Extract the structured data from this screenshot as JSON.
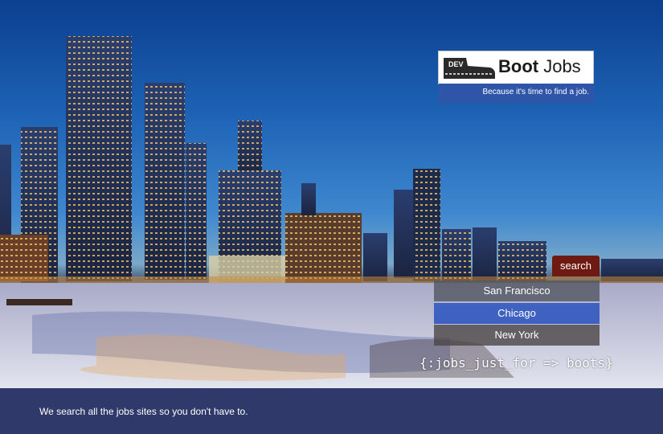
{
  "logo": {
    "icon_text": "DEV",
    "title_bold": "Boot",
    "title_rest": " Jobs",
    "tagline": "Because it's time to find a job."
  },
  "search": {
    "button_label": "search"
  },
  "cities": [
    "San Francisco",
    "Chicago",
    "New York"
  ],
  "selected_city": "Chicago",
  "code_tag": "{:jobs_just_for => boots}",
  "footer": {
    "text": "We search all the jobs sites so you don't have to."
  },
  "colors": {
    "footer_bg": "#2f3a6a",
    "search_button": "#6e1a12",
    "selected_city_bg": "#3f62c2",
    "logo_band": "#2f55a8"
  },
  "icons": [
    "boot-icon"
  ]
}
